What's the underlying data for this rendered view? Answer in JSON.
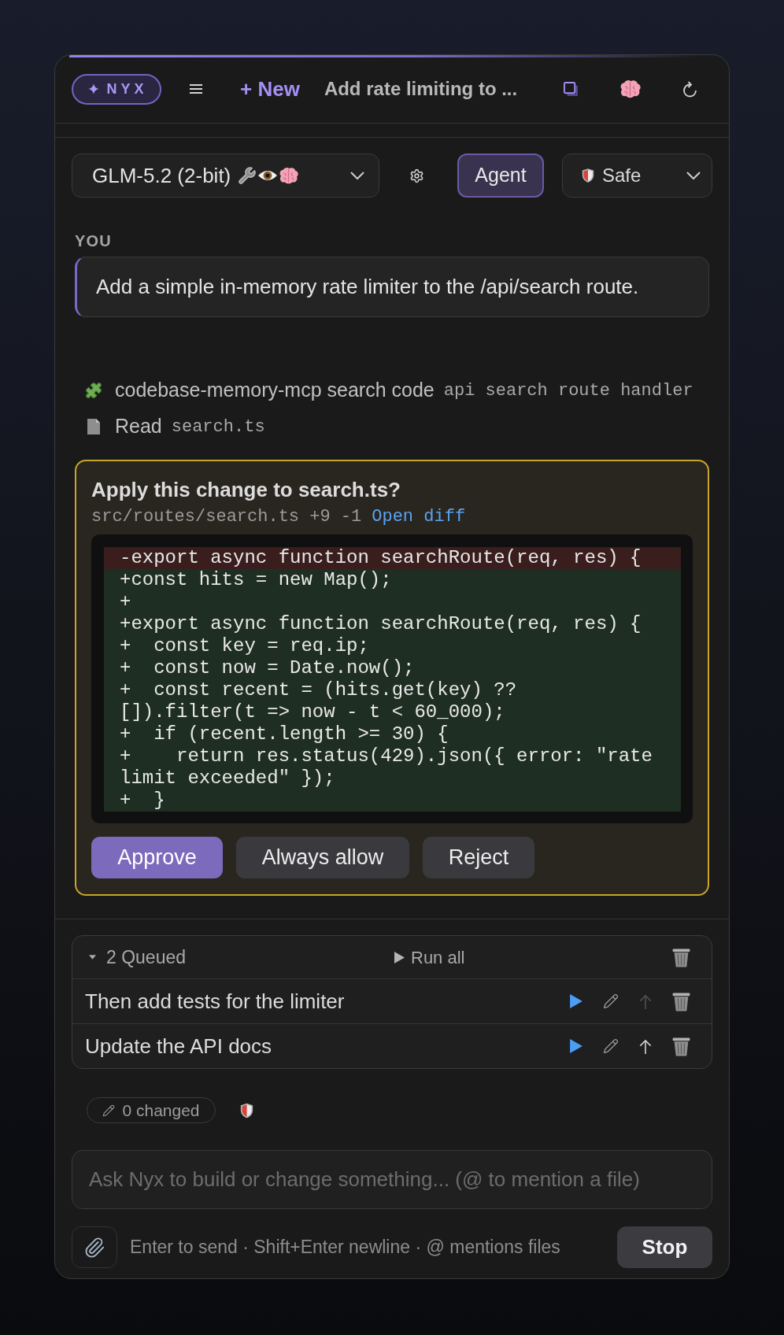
{
  "header": {
    "brand": "NYX",
    "new_button": "+ New",
    "title": "Add rate limiting to ..."
  },
  "toolbar": {
    "model_select": "GLM-5.2 (2-bit)",
    "agent_toggle": {
      "label": "Agent",
      "on": true
    },
    "mode_select": "Safe"
  },
  "conversation": {
    "sender": "YOU",
    "message": "Add a simple in-memory rate limiter to the /api/search route.",
    "tool_calls": [
      {
        "kind": "mcp",
        "label": "codebase-memory-mcp search code",
        "argument": "api search route handler"
      },
      {
        "kind": "read",
        "label": "Read",
        "argument": "search.ts"
      }
    ],
    "approval": {
      "title": "Apply this change to search.ts?",
      "file_summary": "src/routes/search.ts +9 -1",
      "link": "Open diff",
      "diff": [
        {
          "kind": "removed",
          "text": "-export async function searchRoute(req, res) {"
        },
        {
          "kind": "added",
          "text": "+const hits = new Map();"
        },
        {
          "kind": "added",
          "text": "+"
        },
        {
          "kind": "added",
          "text": "+export async function searchRoute(req, res) {"
        },
        {
          "kind": "added",
          "text": "+  const key = req.ip;"
        },
        {
          "kind": "added",
          "text": "+  const now = Date.now();"
        },
        {
          "kind": "added",
          "text": "+  const recent = (hits.get(key) ?? []).filter(t => now - t < 60_000);"
        },
        {
          "kind": "added",
          "text": "+  if (recent.length >= 30) {"
        },
        {
          "kind": "added",
          "text": "+    return res.status(429).json({ error: \"rate limit exceeded\" });"
        },
        {
          "kind": "added",
          "text": "+  }"
        }
      ],
      "actions": [
        {
          "label": "Approve",
          "kind": "primary"
        },
        {
          "label": "Always allow",
          "kind": "secondary"
        },
        {
          "label": "Reject",
          "kind": "secondary"
        }
      ]
    }
  },
  "queue": {
    "expanded": true,
    "title": "2 Queued",
    "run_all": "Run all",
    "items": [
      {
        "text": "Then add tests for the limiter",
        "move_up_disabled": true
      },
      {
        "text": "Update the API docs",
        "move_up_disabled": false
      }
    ]
  },
  "status": {
    "changed": "0 changed"
  },
  "composer": {
    "placeholder": "Ask Nyx to build or change something... (@ to mention a file)",
    "hint": "Enter to send · Shift+Enter newline · @ mentions files",
    "stop_button": "Stop"
  }
}
